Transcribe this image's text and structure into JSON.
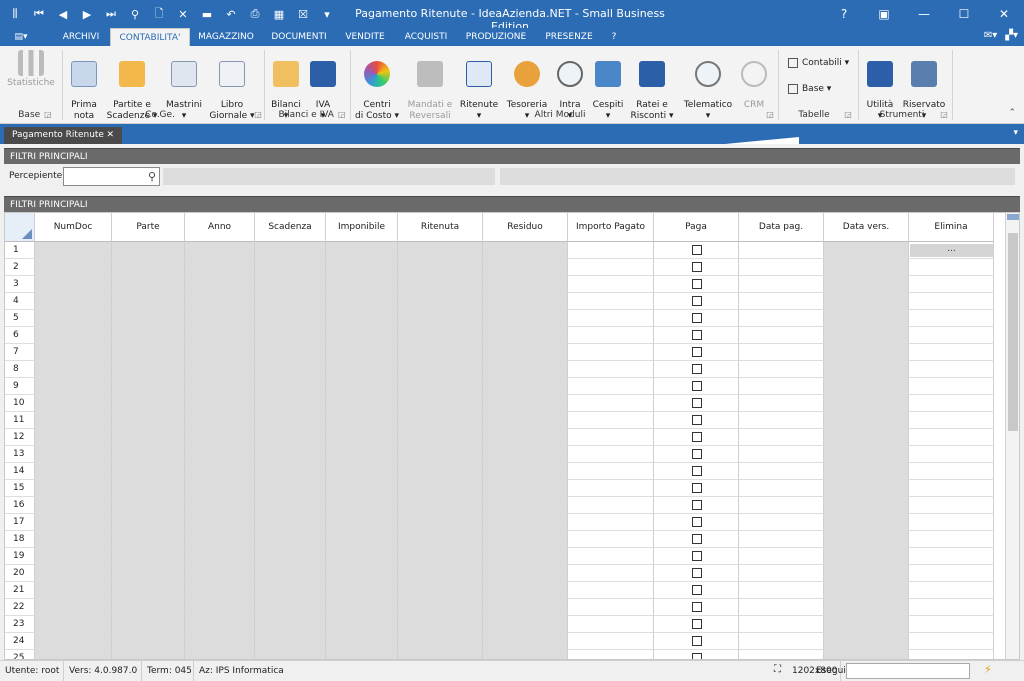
{
  "window": {
    "title": "Pagamento Ritenute - IdeaAzienda.NET - Small Business Edition",
    "help": "?"
  },
  "ribbon_tabs": [
    {
      "label": "ARCHIVI"
    },
    {
      "label": "CONTABILITA'",
      "active": true
    },
    {
      "label": "MAGAZZINO"
    },
    {
      "label": "DOCUMENTI"
    },
    {
      "label": "VENDITE"
    },
    {
      "label": "ACQUISTI"
    },
    {
      "label": "PRODUZIONE"
    },
    {
      "label": "PRESENZE"
    },
    {
      "label": "?"
    }
  ],
  "ribbon": {
    "statistiche": "Statistiche",
    "prima_nota": "Prima\nnota",
    "partite": "Partite e\nScadenze ▾",
    "mastrini": "Mastrini\n▾",
    "libro": "Libro\nGiornale ▾",
    "bilanci": "Bilanci\n▾",
    "iva": "IVA\n▾",
    "centri": "Centri\ndi Costo ▾",
    "mandati": "Mandati e\nReversali",
    "ritenute": "Ritenute\n▾",
    "tesoreria": "Tesoreria\n▾",
    "intra": "Intra\n▾",
    "cespiti": "Cespiti\n▾",
    "ratei": "Ratei e\nRisconti ▾",
    "telematico": "Telematico\n▾",
    "crm": "CRM",
    "contabili": "Contabili ▾",
    "base": "Base ▾",
    "utilita": "Utilità\n▾",
    "riservato": "Riservato\n▾",
    "groups": {
      "base": "Base",
      "coge": "Co.Ge.",
      "bilanci_iva": "Bilanci e IVA",
      "altri": "Altri Moduli",
      "tabelle": "Tabelle",
      "strumenti": "Strumenti"
    }
  },
  "doc_tab": {
    "label": "Pagamento Ritenute",
    "close": "✕"
  },
  "filters": {
    "header": "FILTRI PRINCIPALI",
    "percepiente_label": "Percepiente"
  },
  "grid": {
    "header": "FILTRI PRINCIPALI",
    "columns": [
      "NumDoc",
      "Parte",
      "Anno",
      "Scadenza",
      "Imponibile",
      "Ritenuta",
      "Residuo",
      "Importo Pagato",
      "Paga",
      "Data pag.",
      "Data vers.",
      "Elimina"
    ],
    "row_numbers": [
      "1",
      "2",
      "3",
      "4",
      "5",
      "6",
      "7",
      "8",
      "9",
      "10",
      "11",
      "12",
      "13",
      "14",
      "15",
      "16",
      "17",
      "18",
      "19",
      "20",
      "21",
      "22",
      "23",
      "24",
      "25"
    ],
    "elimina_button": "..."
  },
  "status": {
    "utente": "Utente: root",
    "vers": "Vers: 4.0.987.0",
    "term": "Term: 045",
    "az": "Az: IPS Informatica",
    "resolution": "1202x800",
    "esegui": "Esegui"
  },
  "colors": {
    "accent": "#2b6cb4",
    "section_header": "#6a6a6a",
    "readonly_cell": "#dcdcdc"
  }
}
